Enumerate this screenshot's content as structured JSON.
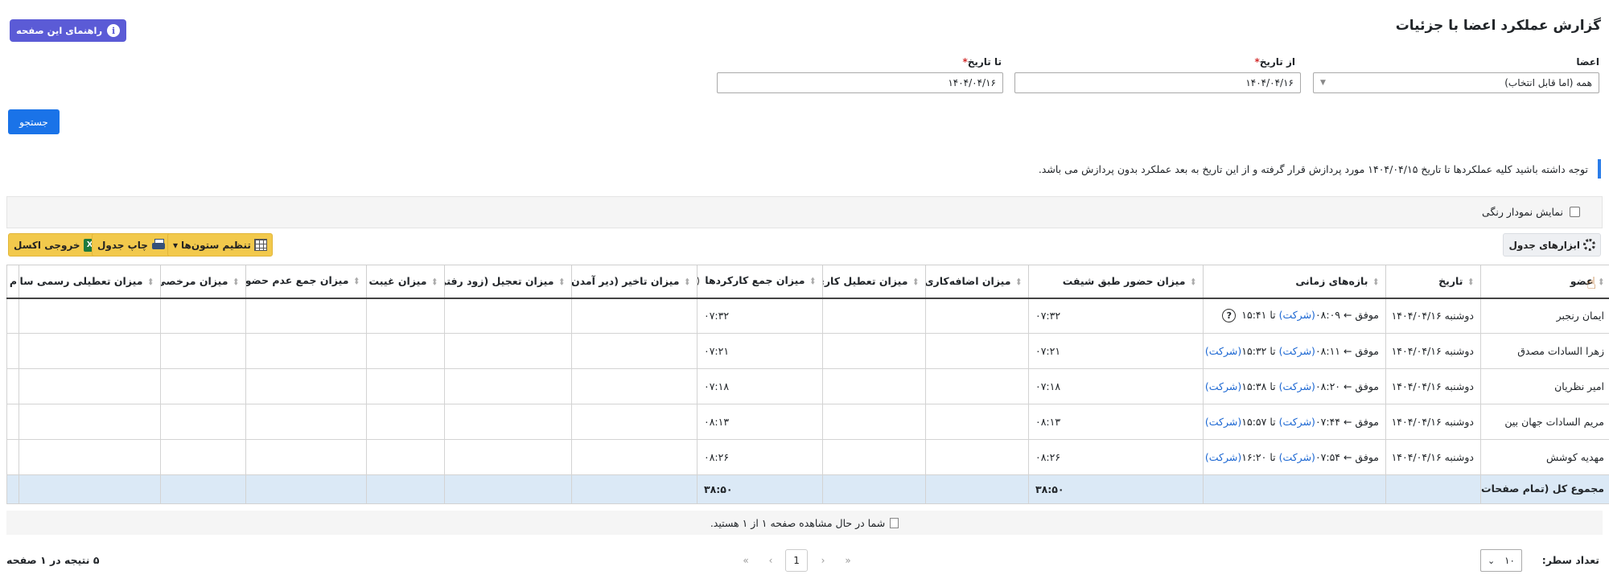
{
  "page": {
    "title": "گزارش عملکرد اعضا با جزئیات",
    "help_label": "راهنمای این صفحه"
  },
  "filters": {
    "members_label": "اعضا",
    "members_value": "همه (اما قابل انتخاب)",
    "from_label": "از تاریخ",
    "from_value": "۱۴۰۴/۰۴/۱۶",
    "to_label": "تا تاریخ",
    "to_value": "۱۴۰۴/۰۴/۱۶",
    "required_mark": "*",
    "search_label": "جستجو"
  },
  "notice": "توجه داشته باشید کلیه عملکردها تا تاریخ ۱۴۰۴/۰۴/۱۵ مورد پردازش قرار گرفته و از این تاریخ به بعد عملکرد بدون پردازش می باشد.",
  "color_chart_label": "نمایش نمودار رنگی",
  "toolbar": {
    "tools_label": "ابزارهای جدول",
    "excel_label": "خروجی اکسل",
    "print_label": "چاپ جدول",
    "columns_label": "تنظیم ستون‌ها",
    "excel_icon": "x-icon",
    "columns_caret": "▾"
  },
  "table": {
    "headers": [
      "عضو",
      "تاریخ",
      "بازه‌های زمانی",
      "میزان حضور طبق شیفت",
      "میزان اضافه‌کاری",
      "میزان تعطیل کاری",
      "میزان جمع کارکردها",
      "میزان تاخیر (دیر آمدن)",
      "میزان تعجیل (زود رفتن)",
      "میزان غیبت",
      "میزان جمع عدم حضورها",
      "میزان مرخصی",
      "میزان تعطیلی رسمی سازمان",
      "م"
    ],
    "sort_icon": "⬍",
    "help_q": "?",
    "rows": [
      {
        "member": "ایمان رنجبر",
        "date": "دوشنبه ۱۴۰۴/۰۴/۱۶",
        "range_prefix": "موفق ← ۰۸:۰۹",
        "range_loc1": "(شرکت)",
        "range_mid": " تا ۱۵:۴۱",
        "range_loc2": "",
        "presence": "۰۷:۳۲",
        "total": "۰۷:۳۲",
        "has_q": true
      },
      {
        "member": "زهرا السادات مصدق",
        "date": "دوشنبه ۱۴۰۴/۰۴/۱۶",
        "range_prefix": "موفق ← ۰۸:۱۱",
        "range_loc1": "(شرکت)",
        "range_mid": " تا ۱۵:۳۲",
        "range_loc2": "(شرکت)",
        "presence": "۰۷:۲۱",
        "total": "۰۷:۲۱",
        "has_q": false
      },
      {
        "member": "امیر نظریان",
        "date": "دوشنبه ۱۴۰۴/۰۴/۱۶",
        "range_prefix": "موفق ← ۰۸:۲۰",
        "range_loc1": "(شرکت)",
        "range_mid": " تا ۱۵:۳۸",
        "range_loc2": "(شرکت)",
        "presence": "۰۷:۱۸",
        "total": "۰۷:۱۸",
        "has_q": false
      },
      {
        "member": "مریم السادات جهان بین",
        "date": "دوشنبه ۱۴۰۴/۰۴/۱۶",
        "range_prefix": "موفق ← ۰۷:۴۴",
        "range_loc1": "(شرکت)",
        "range_mid": " تا ۱۵:۵۷",
        "range_loc2": "(شرکت)",
        "presence": "۰۸:۱۳",
        "total": "۰۸:۱۳",
        "has_q": false
      },
      {
        "member": "مهدیه کوشش",
        "date": "دوشنبه ۱۴۰۴/۰۴/۱۶",
        "range_prefix": "موفق ← ۰۷:۵۴",
        "range_loc1": "(شرکت)",
        "range_mid": " تا ۱۶:۲۰",
        "range_loc2": "(شرکت)",
        "presence": "۰۸:۲۶",
        "total": "۰۸:۲۶",
        "has_q": false
      }
    ],
    "total_label": "مجموع کل (تمام صفحات)",
    "total_presence": "۳۸:۵۰",
    "total_total": "۳۸:۵۰"
  },
  "pager": {
    "info": "شما در حال مشاهده صفحه ۱ از ۱ هستید.",
    "rows_label": "تعداد سطر:",
    "rows_value": "۱۰",
    "results": "۵ نتیجه در ۱ صفحه",
    "current_page": "1",
    "first": "«",
    "prev": "‹",
    "next": "›",
    "last": "»"
  }
}
